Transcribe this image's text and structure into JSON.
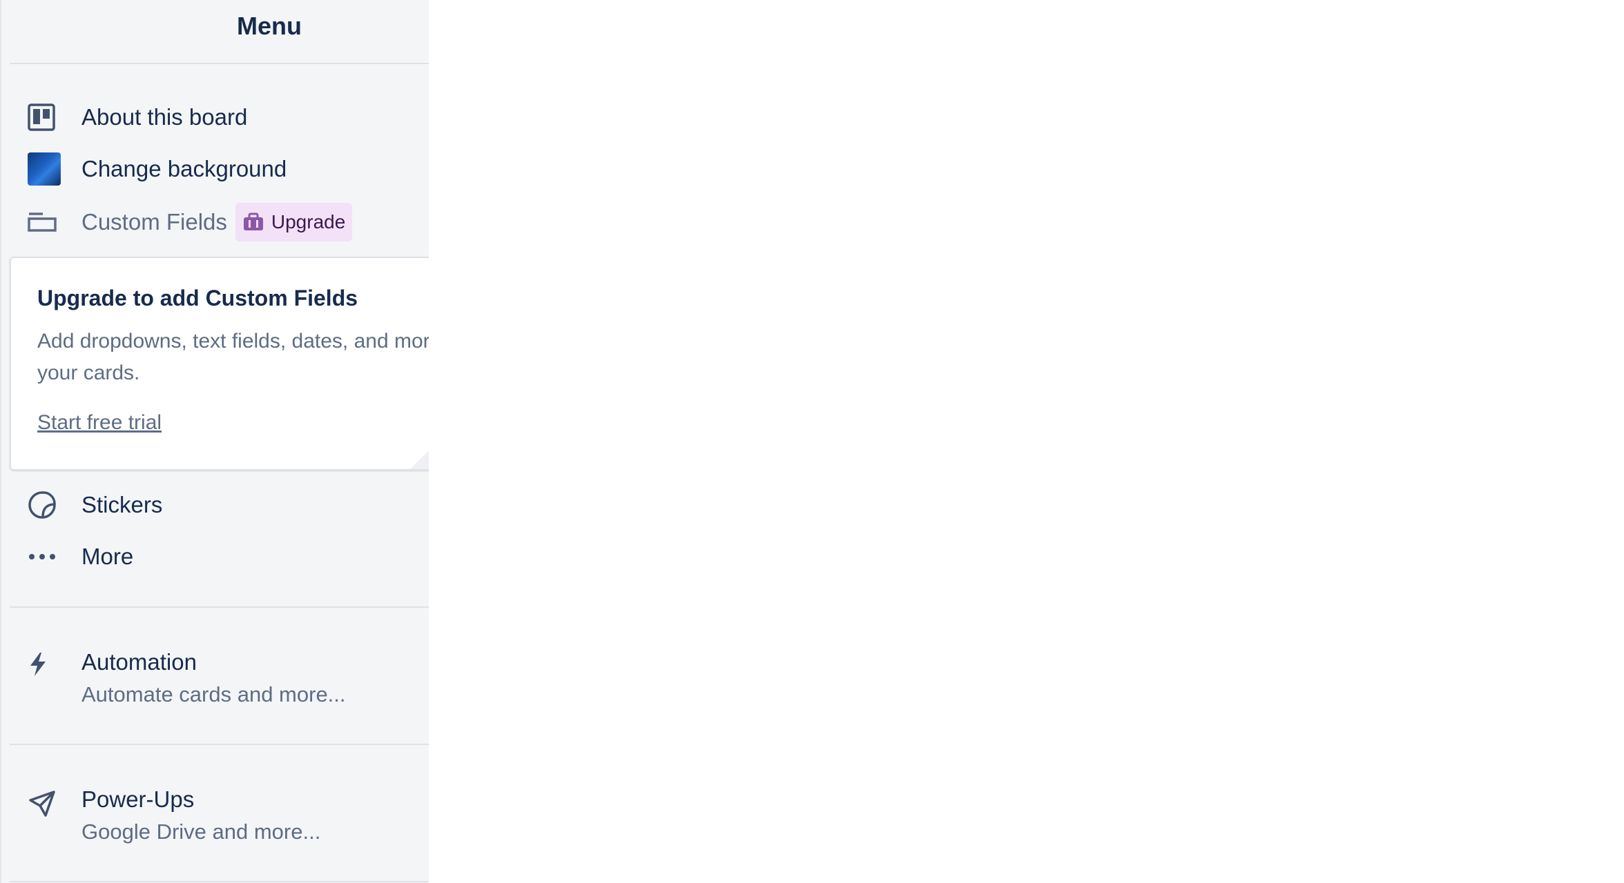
{
  "menu": {
    "title": "Menu"
  },
  "items": {
    "about": "About this board",
    "change_background": "Change background",
    "custom_fields": "Custom Fields",
    "upgrade_badge": "Upgrade",
    "stickers": "Stickers",
    "more": "More"
  },
  "upsell": {
    "title": "Upgrade to add Custom Fields",
    "description": "Add dropdowns, text fields, dates, and more to your cards.",
    "link": "Start free trial"
  },
  "automation": {
    "title": "Automation",
    "subtitle": "Automate cards and more..."
  },
  "powerups": {
    "title": "Power-Ups",
    "subtitle": "Google Drive and more..."
  },
  "colors": {
    "text": "#172b4d",
    "muted": "#5e6c84",
    "panel_bg": "#f4f5f7",
    "badge_bg": "#f3e1f8",
    "badge_icon": "#8b58a6"
  },
  "icons": {
    "about": "board-icon",
    "change_background": "background-swatch",
    "custom_fields": "custom-field-icon",
    "upgrade_badge": "briefcase-icon",
    "stickers": "sticker-icon",
    "more": "ellipsis-icon",
    "automation": "lightning-icon",
    "powerups": "rocket-icon"
  }
}
